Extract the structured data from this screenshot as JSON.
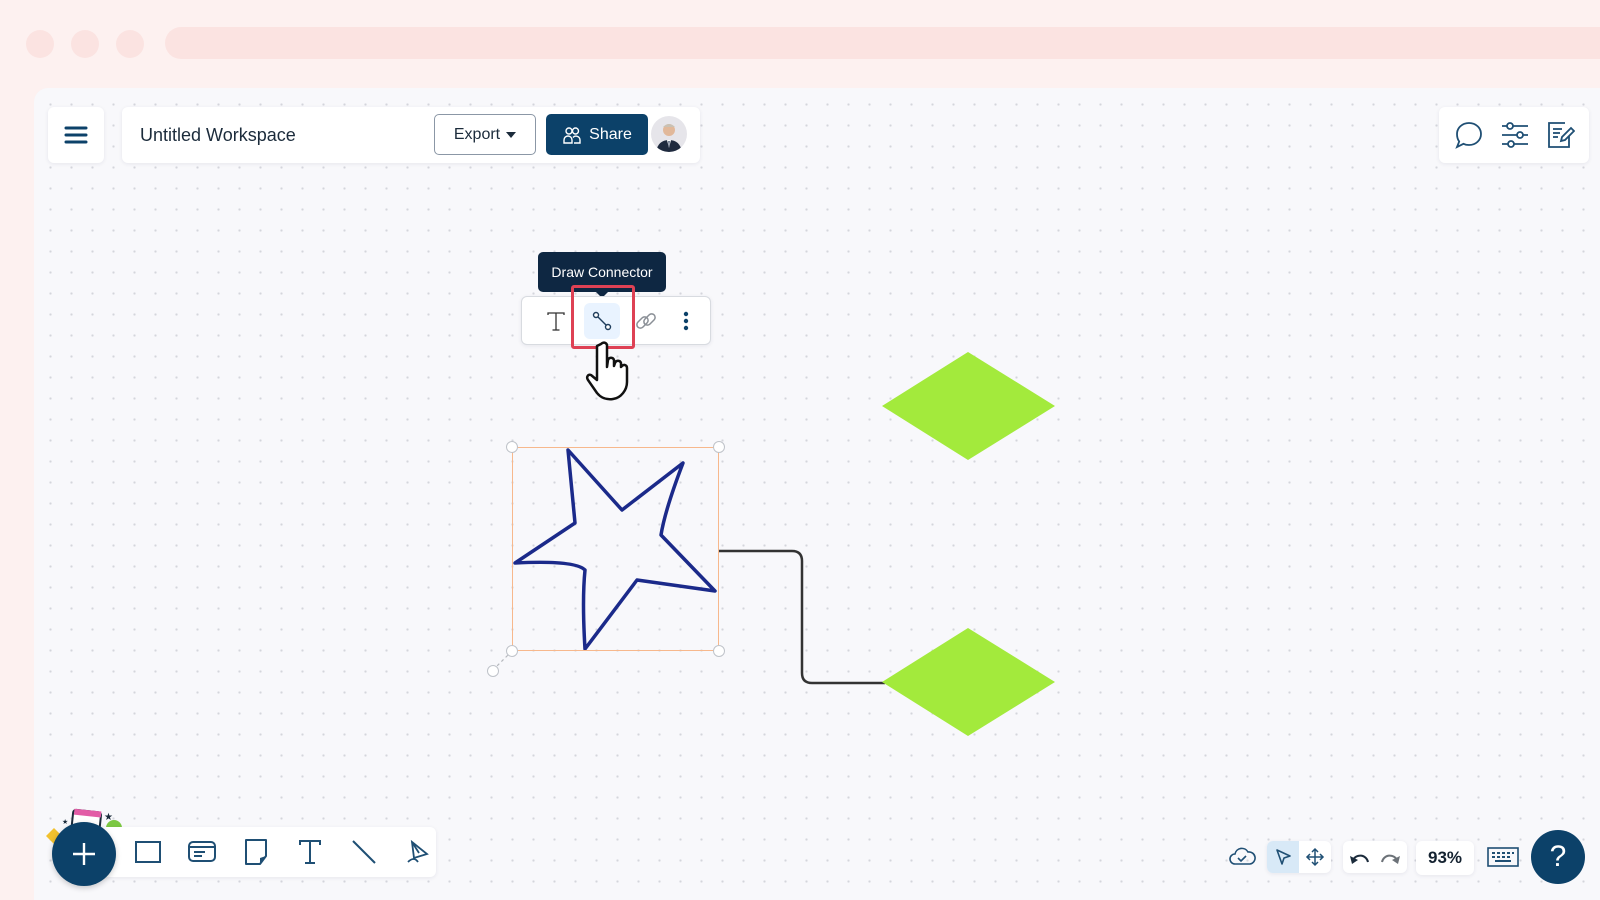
{
  "window": {
    "controls": [
      "close",
      "minimize",
      "maximize"
    ]
  },
  "header": {
    "menu_icon": "hamburger-menu-icon",
    "workspace_title": "Untitled Workspace",
    "export_label": "Export",
    "share_label": "Share",
    "avatar": "user-avatar"
  },
  "right_toolbar": {
    "items": [
      "comments-icon",
      "settings-sliders-icon",
      "notes-edit-icon"
    ]
  },
  "context_toolbar": {
    "tooltip": "Draw Connector",
    "items": [
      "text-icon",
      "connector-icon",
      "link-icon",
      "more-options-icon"
    ],
    "active_item": "connector-icon"
  },
  "canvas": {
    "shapes": [
      {
        "type": "star",
        "stroke": "#1b2a8a",
        "selected": true
      },
      {
        "type": "diamond",
        "fill": "#a3ea3c"
      },
      {
        "type": "diamond",
        "fill": "#a3ea3c"
      }
    ],
    "connector_color": "#333333",
    "selection_color": "#f7b88c"
  },
  "bottom_toolbar": {
    "add_button": "+",
    "tools": [
      "rectangle-tool",
      "card-tool",
      "sticky-note-tool",
      "text-tool",
      "line-tool",
      "pen-tool"
    ]
  },
  "status_bar": {
    "save_status_icon": "cloud-saved-icon",
    "modes": [
      "select-mode",
      "pan-mode"
    ],
    "active_mode": "select-mode",
    "zoom": "93%",
    "help": "?"
  },
  "colors": {
    "brand": "#0c4169",
    "tooltip_bg": "#0e2742",
    "highlight": "#de4154"
  }
}
